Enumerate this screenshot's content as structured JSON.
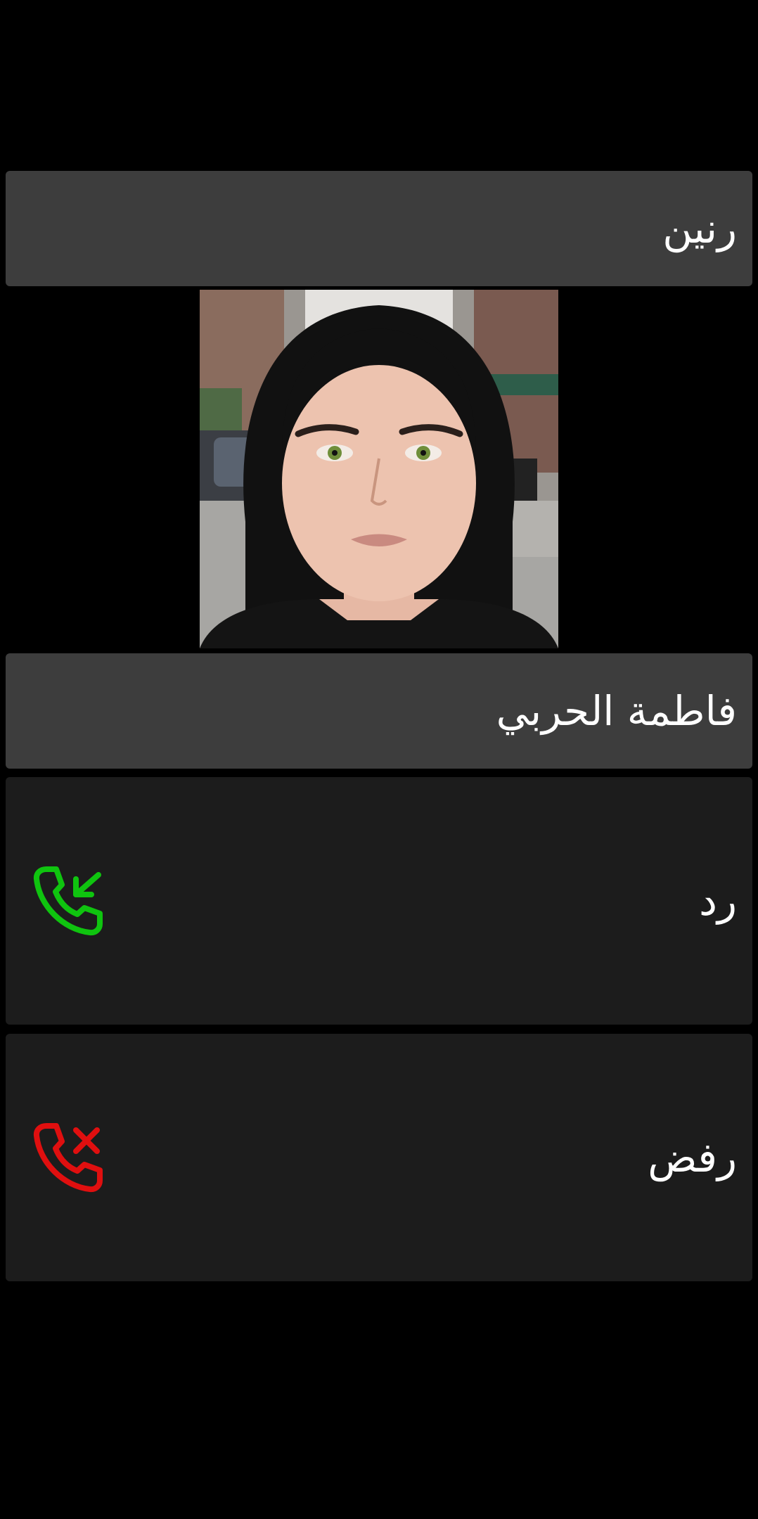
{
  "call": {
    "status_label": "رنين",
    "caller_name": "فاطمة الحربي",
    "answer_label": "رد",
    "decline_label": "رفض"
  },
  "icons": {
    "answer": "incoming-call-icon",
    "decline": "call-reject-icon"
  },
  "colors": {
    "answer": "#0fc40f",
    "decline": "#e00f0f",
    "panel": "#3d3d3d",
    "action_panel": "#1c1c1c",
    "background": "#000000"
  }
}
